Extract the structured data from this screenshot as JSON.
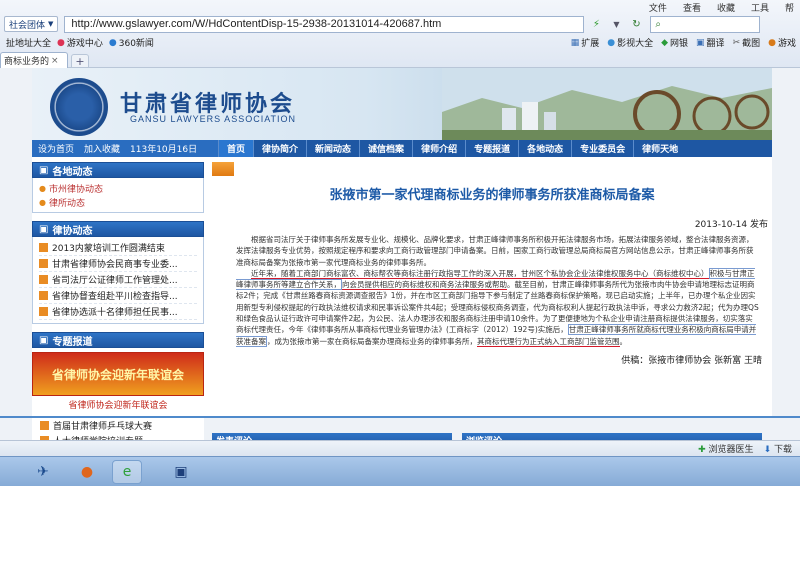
{
  "browser": {
    "menu": [
      "文件",
      "查看",
      "收藏",
      "工具",
      "帮"
    ],
    "site_dropdown": "社会团体",
    "url": "http://www.gslawyer.com/W/HdContentDisp-15-2938-20131014-420687.htm",
    "favorites": [
      "扯地址大全",
      "游戏中心",
      "360新闻"
    ],
    "tools": [
      "扩展",
      "影视大全",
      "网银",
      "翻译",
      "截图",
      "游戏"
    ],
    "tab_label": "商标业务的",
    "status_text": [
      "浏览器医生",
      "下载"
    ]
  },
  "site": {
    "brand_cn": "甘肃省律师协会",
    "brand_en": "GANSU LAWYERS ASSOCIATION",
    "nav_left": [
      "设为首页",
      "加入收藏"
    ],
    "today": "113年10月16日",
    "nav": [
      "首页",
      "律协简介",
      "新闻动态",
      "诚信档案",
      "律师介绍",
      "专题报道",
      "各地动态",
      "专业委员会",
      "律师天地"
    ]
  },
  "sidebar": {
    "local_title": "各地动态",
    "local_links": [
      "市州律协动态",
      "律所动态"
    ],
    "assoc_title": "律协动态",
    "assoc_news": [
      "2013内蒙培训工作圆满结束",
      "甘肃省律师协会民商事专业委...",
      "省司法厅公证律师工作管理处...",
      "省律协督查组赴平川检查指导...",
      "省律协选派十名律师担任民事..."
    ],
    "special_title": "专题报道",
    "promo_text": "省律师协会迎新年联谊会",
    "promo_link": "省律师协会迎新年联谊会",
    "lower_news": [
      "首届甘肃律师乒乓球大赛",
      "人大律师学院培训专题"
    ]
  },
  "article": {
    "title": "张掖市第一家代理商标业务的律师事务所获准商标局备案",
    "date": "2013-10-14 发布",
    "p1": "根据省司法厅关于律师事务所发展专业化、规模化、品牌化要求，甘肃正峰律师事务所积极开拓法律服务市场，拓展法律服务领域，整合法律服务资源，发挥法律服务专业优势，按照规定程序和要求向工商行政管理部门申请备案。日前，国家工商行政管理总局商标局官方网站信息公示，甘肃正峰律师事务所获准商标局备案为张掖市第一家代理商标业务的律师事务所。",
    "p2_a": "近年来，",
    "p2_b": "随着工商部门商标富农、商标帮农等商标注册行政指导工作的深入开展，",
    "p2_c": "甘州区个私协会企业法律维权服务中心（商标维权中心）",
    "p2_d": "积极与甘肃正峰律师事务所等建立合作关系，",
    "p2_e": "向会员提供相应的商标维权和商务法律服务或帮助",
    "p2_f": "。截至目前，甘肃正峰律师事务所代为张掖市肉牛协会申请地理标志证明商标2件；完成《甘肃丝路春商标资源调查报告》1份，并在市区工商部门指导下参与制定了丝路春商标保护策略，现已启动实施；上半年，已办理个私企业因实用新型专利侵权提起的行政执法维权请求和民事诉讼案件共4起；受理商标侵权商务调查，代为商标权利人提起行政执法申诉，寻求公力救济2起；代为办理QS和绿色食品认证行政许可申请案件2起，为公民、法人办理涉农和服务商标注册申请10余件。为了更便捷地为个私企业申请注册商标提供法律服务，切实落实商标代理责任，今年《律师事务所从事商标代理业务管理办法》(工商标字（2012）192号)实施后，",
    "p2_g": "甘肃正峰律师事务所就商标代理业务积极向商标局申请并获准备案",
    "p2_h": "，成为张掖市第一家在商标局备案办理商标业务的律师事务所，",
    "p2_i": "其商标代理行为正式纳入工商部门监管范围",
    "p2_j": "。",
    "source": "供稿：张掖市律师协会 张新富 王晴"
  },
  "lower": {
    "comment_left": "发表评论",
    "comment_right": "浏览评论"
  }
}
